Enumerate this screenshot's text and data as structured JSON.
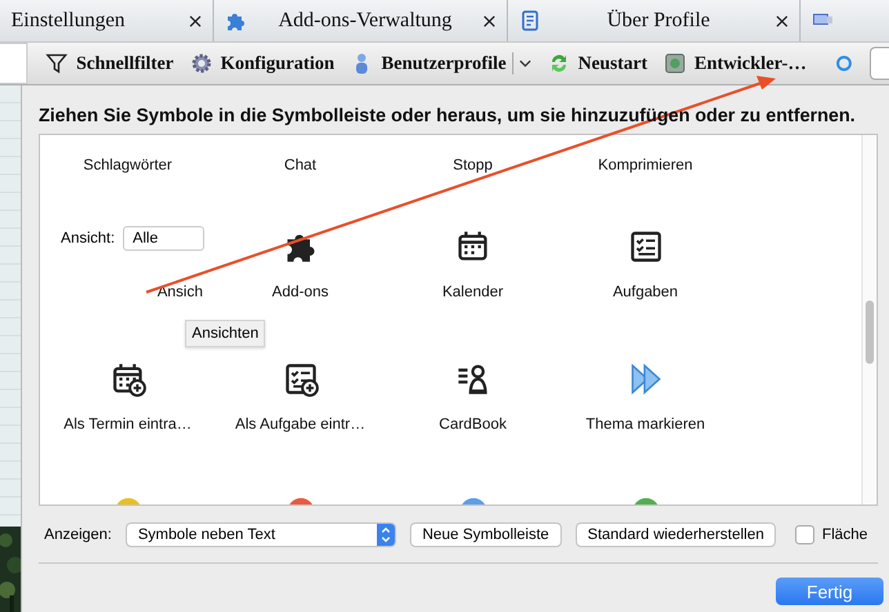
{
  "tabs": [
    {
      "label": "Einstellungen",
      "kind": "plain"
    },
    {
      "label": "Add-ons-Verwaltung",
      "kind": "puzzle"
    },
    {
      "label": "Über Profile",
      "kind": "document"
    },
    {
      "kind": "screen"
    }
  ],
  "toolbar": [
    {
      "label": "Schnellfilter",
      "kind": "filter",
      "menu": false
    },
    {
      "label": "Konfiguration",
      "kind": "gear",
      "menu": false
    },
    {
      "label": "Benutzerprofile",
      "kind": "person",
      "menu": true
    },
    {
      "label": "Neustart",
      "kind": "restart",
      "menu": false
    },
    {
      "label": "Entwickler-…",
      "kind": "developer",
      "menu": false
    }
  ],
  "dialog": {
    "heading": "Ziehen Sie Symbole in die Symbolleiste oder heraus, um sie hinzuzufügen oder zu entfernen.",
    "palette": [
      {
        "label": "Schlagwörter",
        "kind": "text"
      },
      {
        "label": "Chat",
        "kind": "text"
      },
      {
        "label": "Stopp",
        "kind": "text"
      },
      {
        "label": "Komprimieren",
        "kind": "text"
      },
      {
        "label": "Ansich",
        "kind": "view-select",
        "field_label": "Ansicht:",
        "value": "Alle"
      },
      {
        "label": "Add-ons",
        "kind": "puzzle"
      },
      {
        "label": "Kalender",
        "kind": "calendar"
      },
      {
        "label": "Aufgaben",
        "kind": "tasks"
      },
      {
        "label": "Als Termin eintra…",
        "kind": "calendar-add"
      },
      {
        "label": "Als Aufgabe eintr…",
        "kind": "tasks-add"
      },
      {
        "label": "CardBook",
        "kind": "contact"
      },
      {
        "label": "Thema markieren",
        "kind": "forward"
      },
      {
        "kind": "partial-yellow"
      },
      {
        "kind": "partial-red"
      },
      {
        "kind": "partial-blue"
      },
      {
        "kind": "partial-green"
      }
    ],
    "tooltip": "Ansichten",
    "show_label": "Anzeigen:",
    "show_value": "Symbole neben Text",
    "buttons": [
      "Neue Symbolleiste",
      "Standard wiederherstellen"
    ],
    "checkbox": {
      "label": "Fläche",
      "checked": false
    },
    "done": "Fertig"
  }
}
